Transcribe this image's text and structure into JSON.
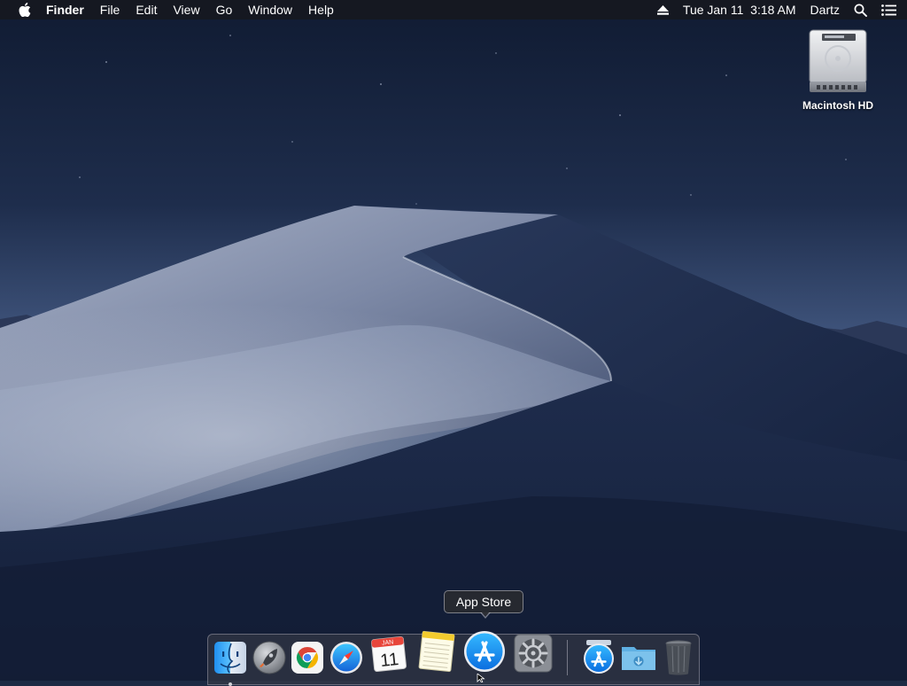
{
  "menubar": {
    "apple_icon": "apple-logo-icon",
    "app_name": "Finder",
    "items": [
      "File",
      "Edit",
      "View",
      "Go",
      "Window",
      "Help"
    ],
    "status": {
      "eject_icon": "eject-icon",
      "datetime": "Tue Jan 11  3:18 AM",
      "user": "Dartz",
      "spotlight_icon": "search-icon",
      "notification_icon": "list-icon"
    }
  },
  "desktop": {
    "icons": [
      {
        "label": "Macintosh HD",
        "icon": "hard-drive-icon"
      }
    ]
  },
  "tooltip": {
    "text": "App Store"
  },
  "dock": {
    "apps": [
      {
        "name": "Finder",
        "icon": "finder-icon",
        "running": true
      },
      {
        "name": "Launchpad",
        "icon": "rocket-icon"
      },
      {
        "name": "Google Chrome",
        "icon": "chrome-icon"
      },
      {
        "name": "Safari",
        "icon": "compass-icon"
      },
      {
        "name": "Calendar",
        "icon": "calendar-icon",
        "month": "JAN",
        "day": "11"
      },
      {
        "name": "Notes",
        "icon": "notepad-icon"
      },
      {
        "name": "App Store",
        "icon": "app-store-icon"
      },
      {
        "name": "System Preferences",
        "icon": "gear-icon"
      }
    ],
    "others": [
      {
        "name": "Applications",
        "icon": "app-store-icon"
      },
      {
        "name": "Downloads",
        "icon": "folder-download-icon"
      },
      {
        "name": "Trash",
        "icon": "trash-icon"
      }
    ]
  },
  "colors": {
    "menubar_bg": "#16181f",
    "sky_top": "#0f1a31",
    "sky_horizon": "#40557d",
    "dune_light": "#b9c0d3",
    "dune_dark": "#1b2948"
  }
}
